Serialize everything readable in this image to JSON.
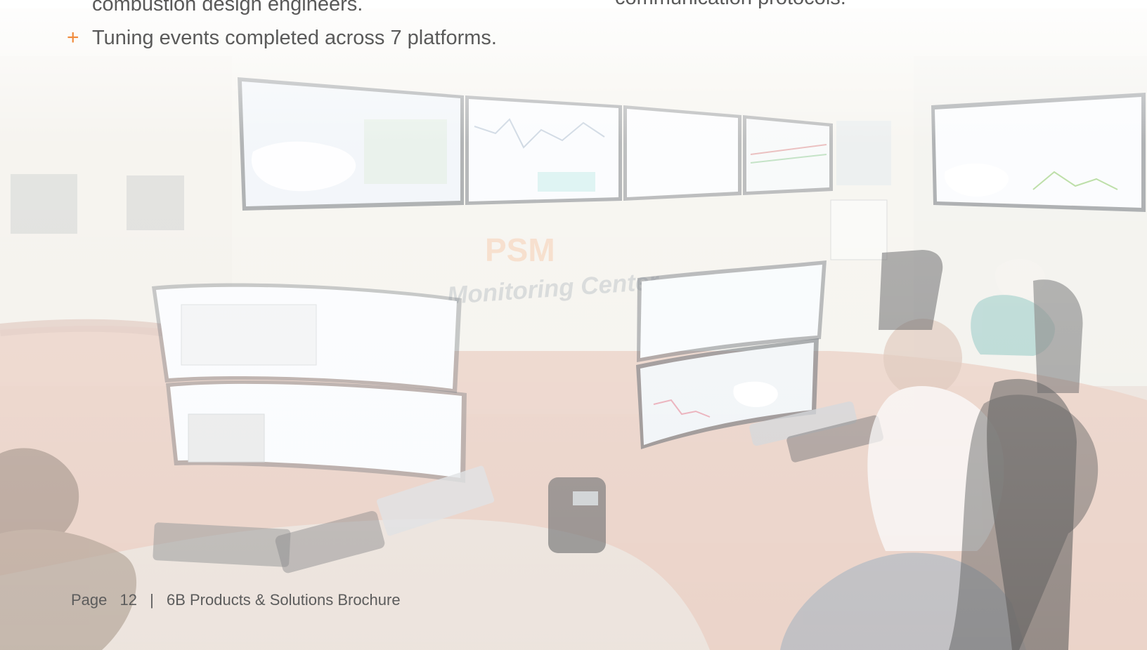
{
  "document": {
    "bullets": [
      "combustion design engineers.",
      "Tuning events completed across 7 platforms."
    ],
    "right_column_text": "communication protocols.",
    "bullet_marker": "+",
    "photo": {
      "signage": "PSM",
      "center_label": "Monitoring Center",
      "icon": "monitoring-center-photo"
    },
    "footer": {
      "page_label": "Page",
      "page_number": "12",
      "separator": "|",
      "title": "6B Products & Solutions Brochure"
    }
  },
  "colors": {
    "accent": "#f08a3b",
    "text": "#5a5a5a",
    "background": "#ffffff"
  }
}
